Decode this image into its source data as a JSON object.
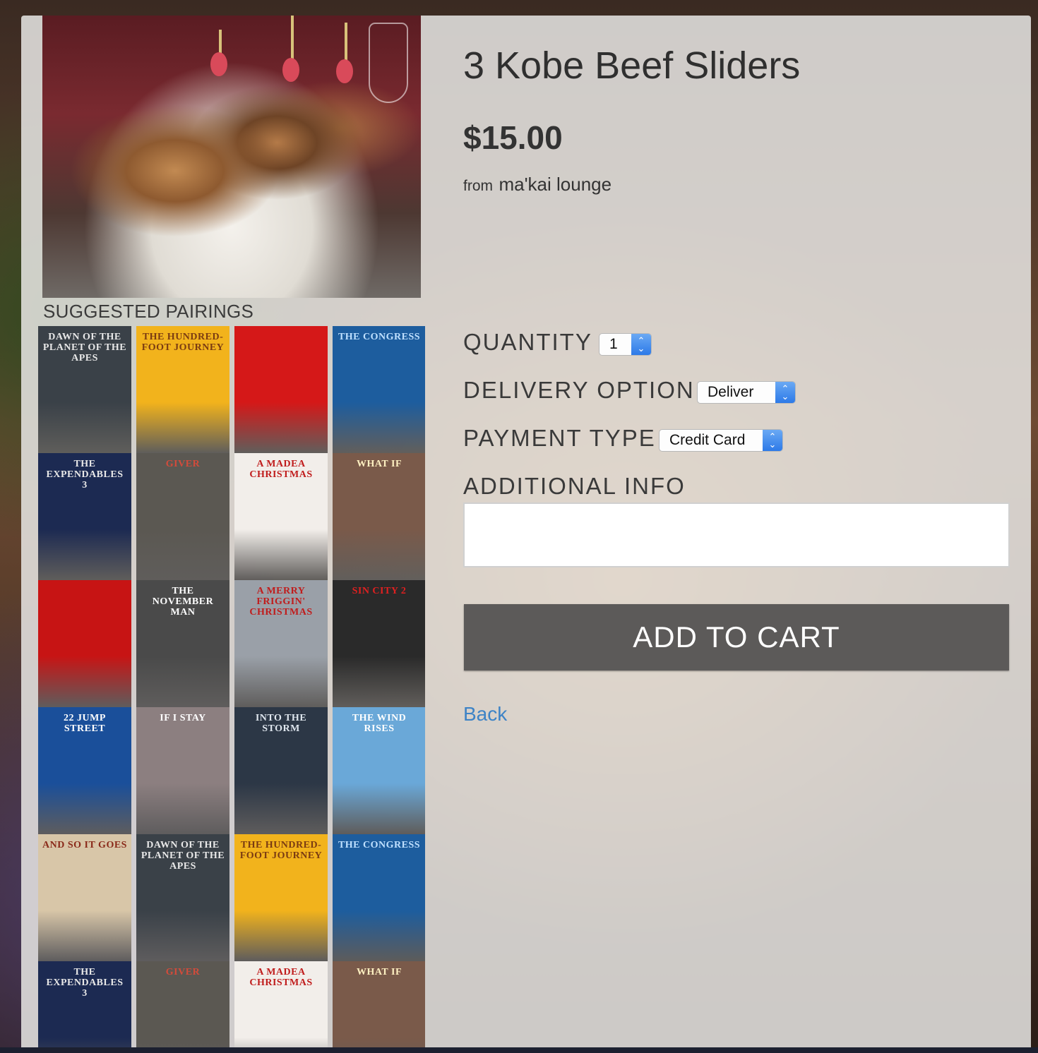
{
  "product": {
    "title": "3 Kobe Beef Sliders",
    "price": "$15.00",
    "from_prefix": "from",
    "restaurant": "ma'kai lounge"
  },
  "pairings": {
    "heading": "SUGGESTED PAIRINGS",
    "posters": [
      {
        "title": "DAWN of the PLANET of the APES",
        "bg": "#3a4148",
        "fg": "#e8e8e8"
      },
      {
        "title": "THE HUNDRED-FOOT JOURNEY",
        "bg": "#f2b31c",
        "fg": "#7a3b12"
      },
      {
        "title": "",
        "bg": "#d51818",
        "fg": "#1a1a1a"
      },
      {
        "title": "THE CONGRESS",
        "bg": "#1d5d9e",
        "fg": "#bfe0ff"
      },
      {
        "title": "THE EXPENDABLES 3",
        "bg": "#1c2a52",
        "fg": "#e8e8e8"
      },
      {
        "title": "GIVER",
        "bg": "#5b5852",
        "fg": "#d34b3b"
      },
      {
        "title": "A Madea Christmas",
        "bg": "#f2eeea",
        "fg": "#c01c1c"
      },
      {
        "title": "What If",
        "bg": "#7a5a4a",
        "fg": "#fff1c2"
      },
      {
        "title": "",
        "bg": "#c71414",
        "fg": "#1a1a1a"
      },
      {
        "title": "THE NOVEMBER MAN",
        "bg": "#4a4a4a",
        "fg": "#ffffff"
      },
      {
        "title": "A MERRY FRIGGIN' CHRISTMAS",
        "bg": "#9aa0a8",
        "fg": "#c01c1c"
      },
      {
        "title": "SIN CITY 2",
        "bg": "#2a2a2a",
        "fg": "#e02020"
      },
      {
        "title": "22 JUMP STREET",
        "bg": "#1a4f9a",
        "fg": "#ffffff"
      },
      {
        "title": "if i stay",
        "bg": "#8c7f80",
        "fg": "#ffffff"
      },
      {
        "title": "INTO THE STORM",
        "bg": "#2c3746",
        "fg": "#dfe6ee"
      },
      {
        "title": "THE WIND RISES",
        "bg": "#6aa8d8",
        "fg": "#ffffff"
      },
      {
        "title": "AND SO IT GOES",
        "bg": "#d8c6a8",
        "fg": "#8a2a1a"
      },
      {
        "title": "DAWN of the PLANET of the APES",
        "bg": "#3a4148",
        "fg": "#e8e8e8"
      },
      {
        "title": "THE HUNDRED-FOOT JOURNEY",
        "bg": "#f2b31c",
        "fg": "#7a3b12"
      },
      {
        "title": "THE CONGRESS",
        "bg": "#1d5d9e",
        "fg": "#bfe0ff"
      },
      {
        "title": "THE EXPENDABLES 3",
        "bg": "#1c2a52",
        "fg": "#e8e8e8"
      },
      {
        "title": "GIVER",
        "bg": "#5b5852",
        "fg": "#d34b3b"
      },
      {
        "title": "A Madea Christmas",
        "bg": "#f2eeea",
        "fg": "#c01c1c"
      },
      {
        "title": "What If",
        "bg": "#7a5a4a",
        "fg": "#fff1c2"
      }
    ]
  },
  "form": {
    "quantity_label": "QUANTITY",
    "quantity_value": "1",
    "delivery_label": "DELIVERY OPTION",
    "delivery_value": "Deliver",
    "payment_label": "PAYMENT TYPE",
    "payment_value": "Credit Card",
    "info_label": "ADDITIONAL INFO",
    "info_value": ""
  },
  "actions": {
    "add_to_cart": "ADD TO CART",
    "back": "Back"
  },
  "colors": {
    "accent_link": "#3d83c6",
    "button_bg": "#5c5a59",
    "select_arrow": "#2d7ae8"
  }
}
